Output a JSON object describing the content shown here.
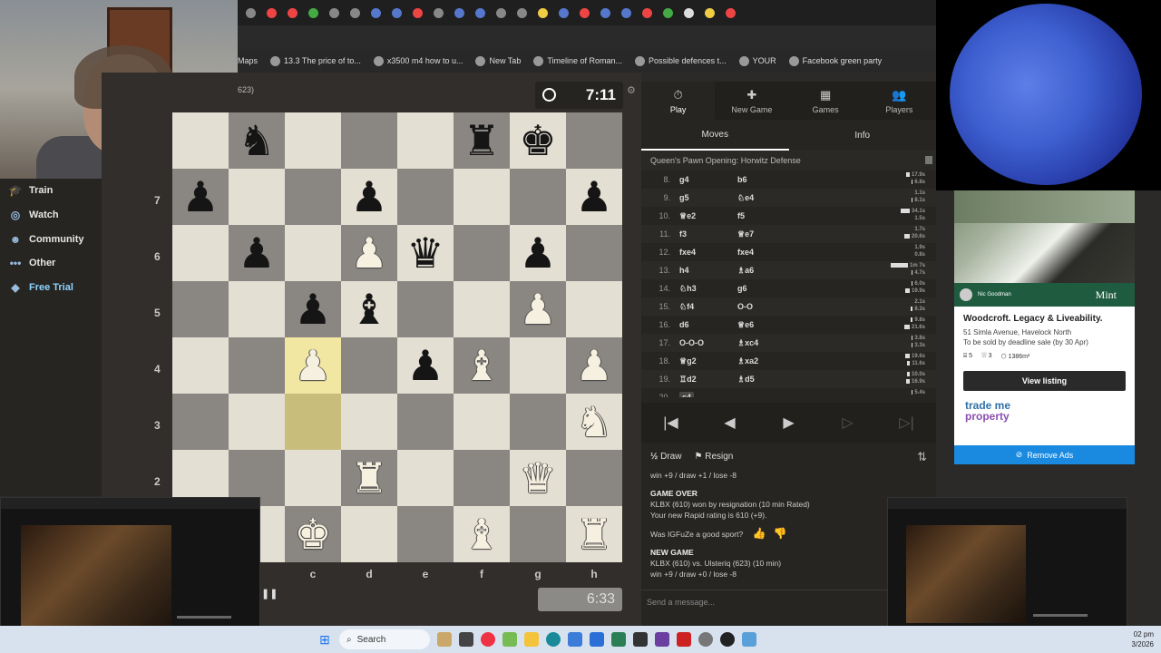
{
  "bookmarks": [
    {
      "label": "Maps"
    },
    {
      "label": "13.3 The price of to..."
    },
    {
      "label": "x3500 m4 how to u..."
    },
    {
      "label": "New Tab"
    },
    {
      "label": "Timeline of Roman..."
    },
    {
      "label": "Possible defences t..."
    },
    {
      "label": "YOUR"
    },
    {
      "label": "Facebook green party"
    }
  ],
  "nav": {
    "train": "Train",
    "watch": "Watch",
    "community": "Community",
    "other": "Other",
    "free_trial": "Free Trial"
  },
  "game": {
    "opponent_rating": "623)",
    "top_clock": "7:11",
    "bottom_clock": "6:33",
    "ranks": [
      "7",
      "6",
      "5",
      "4",
      "3",
      "2"
    ],
    "files": [
      "c",
      "d",
      "e",
      "f",
      "g",
      "h"
    ]
  },
  "board": {
    "rows": [
      [
        "",
        "bn",
        "",
        "",
        "",
        "br",
        "bk",
        ""
      ],
      [
        "bp",
        "",
        "",
        "bp",
        "",
        "",
        "",
        "bp"
      ],
      [
        "",
        "bp",
        "",
        "wp",
        "bq",
        "",
        "bp",
        ""
      ],
      [
        "",
        "",
        "bp",
        "bb",
        "",
        "",
        "wp",
        ""
      ],
      [
        "",
        "",
        "wp",
        "",
        "bp",
        "wb",
        "",
        "wp"
      ],
      [
        "",
        "",
        "",
        "",
        "",
        "",
        "",
        "wn"
      ],
      [
        "",
        "",
        "",
        "wr",
        "",
        "",
        "wq",
        ""
      ],
      [
        "",
        "",
        "wk",
        "",
        "",
        "wb",
        "",
        "wr"
      ]
    ],
    "highlight": [
      [
        4,
        2
      ],
      [
        5,
        2
      ]
    ]
  },
  "panel": {
    "tabs": [
      {
        "label": "Play",
        "icon": "stopwatch-icon"
      },
      {
        "label": "New Game",
        "icon": "plus-icon"
      },
      {
        "label": "Games",
        "icon": "board-icon"
      },
      {
        "label": "Players",
        "icon": "players-icon"
      }
    ],
    "subtabs": {
      "moves": "Moves",
      "info": "Info"
    },
    "opening": "Queen's Pawn Opening: Horwitz Defense",
    "moves": [
      {
        "n": "8.",
        "w": "g4",
        "b": "b6",
        "t1": "17.9s",
        "t2": "6.8s",
        "w1": 0.2,
        "w2": 0.05
      },
      {
        "n": "9.",
        "w": "g5",
        "b": "e4",
        "bp": "♘",
        "t1": "1.1s",
        "t2": "8.1s",
        "w1": 0.02,
        "w2": 0.06
      },
      {
        "n": "10.",
        "w": "e2",
        "wp": "♕",
        "b": "f5",
        "t1": "34.1s",
        "t2": "1.5s",
        "w1": 0.45,
        "w2": 0.02
      },
      {
        "n": "11.",
        "w": "f3",
        "b": "e7",
        "bp": "♕",
        "t1": "1.7s",
        "t2": "20.6s",
        "w1": 0.02,
        "w2": 0.25
      },
      {
        "n": "12.",
        "w": "fxe4",
        "b": "fxe4",
        "t1": "1.9s",
        "t2": "0.8s",
        "w1": 0.02,
        "w2": 0.01
      },
      {
        "n": "13.",
        "w": "h4",
        "b": "a6",
        "bp": "♗",
        "t1": "1m 7s",
        "t2": "4.7s",
        "w1": 0.85,
        "w2": 0.05
      },
      {
        "n": "14.",
        "w": "h3",
        "wp": "♘",
        "b": "g6",
        "t1": "6.0s",
        "t2": "19.9s",
        "w1": 0.06,
        "w2": 0.24
      },
      {
        "n": "15.",
        "w": "f4",
        "wp": "♘",
        "b": "O-O",
        "t1": "2.1s",
        "t2": "8.3s",
        "w1": 0.02,
        "w2": 0.09
      },
      {
        "n": "16.",
        "w": "d6",
        "b": "e6",
        "bp": "♕",
        "t1": "9.8s",
        "t2": "21.6s",
        "w1": 0.11,
        "w2": 0.26
      },
      {
        "n": "17.",
        "w": "O-O-O",
        "b": "xc4",
        "bp": "♗",
        "t1": "3.8s",
        "t2": "3.3s",
        "w1": 0.04,
        "w2": 0.04
      },
      {
        "n": "18.",
        "w": "g2",
        "wp": "♕",
        "b": "xa2",
        "bp": "♗",
        "t1": "19.6s",
        "t2": "11.6s",
        "w1": 0.24,
        "w2": 0.13
      },
      {
        "n": "19.",
        "w": "d2",
        "wp": "♖",
        "b": "d5",
        "bp": "♗",
        "t1": "10.0s",
        "t2": "16.9s",
        "w1": 0.12,
        "w2": 0.2
      },
      {
        "n": "20.",
        "w": "c4",
        "b": "",
        "t1": "5.4s",
        "t2": "",
        "w1": 0.06,
        "w2": 0,
        "current": true
      }
    ],
    "draw": "Draw",
    "draw_icon": "½",
    "resign": "Resign",
    "log": {
      "line0": "win +9 / draw +1 / lose -8",
      "gameover": "GAME OVER",
      "result": "KLBX (610) won by resignation (10 min Rated)",
      "rating": "Your new Rapid rating is 610 (+9).",
      "sport": "Was IGFuZe a good sport?",
      "newgame": "NEW GAME",
      "match": "KLBX (610) vs. Ulsteriq (623) (10 min)",
      "odds": "win +9 / draw +0 / lose -8"
    },
    "send": "Send a message..."
  },
  "ad": {
    "agent": "Nic Goodman",
    "brand": "Mint",
    "title": "Woodcroft. Legacy & Liveability.",
    "address": "51 Simla Avenue, Havelock North",
    "sale": "To be sold by deadline sale (by 30 Apr)",
    "beds": "5",
    "baths": "3",
    "area": "1386m²",
    "view": "View listing",
    "tm1": "trade me",
    "tm2": "property",
    "remove": "Remove Ads"
  },
  "taskbar": {
    "search": "Search",
    "time": "02 pm",
    "date": "3/2026"
  }
}
